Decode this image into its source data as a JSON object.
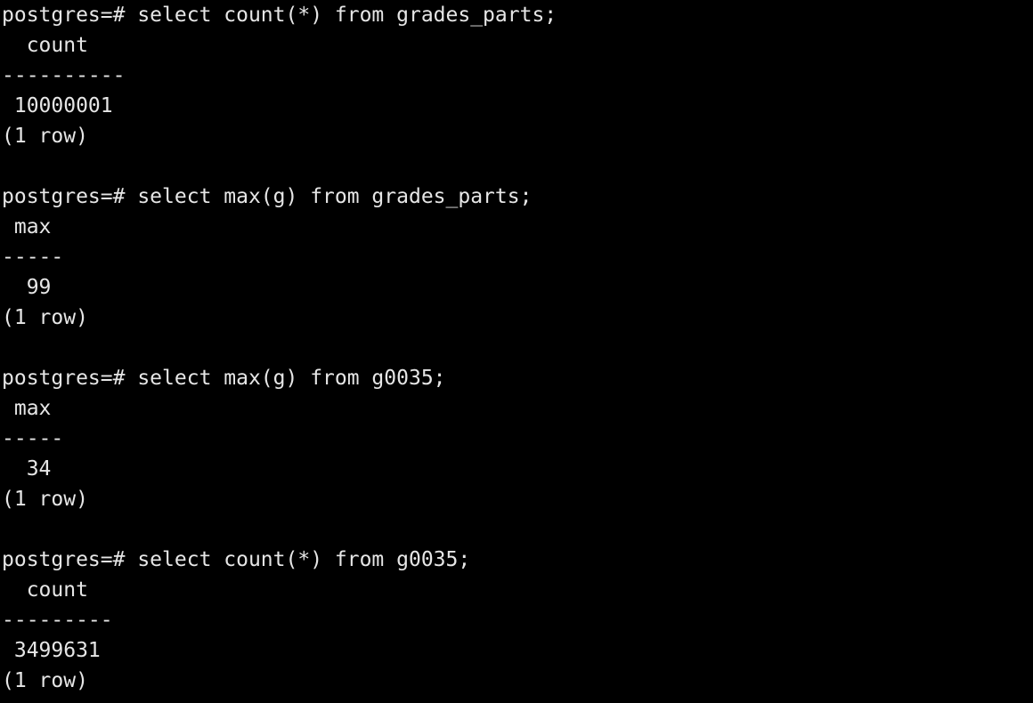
{
  "terminal": {
    "lines": [
      {
        "kind": "command",
        "prompt": "postgres=# ",
        "command": "select count(*) from grades_parts;"
      },
      {
        "kind": "output",
        "text": "  count"
      },
      {
        "kind": "output",
        "text": "----------"
      },
      {
        "kind": "output",
        "text": " 10000001"
      },
      {
        "kind": "output",
        "text": "(1 row)"
      },
      {
        "kind": "blank",
        "text": ""
      },
      {
        "kind": "command",
        "prompt": "postgres=# ",
        "command": "select max(g) from grades_parts;"
      },
      {
        "kind": "output",
        "text": " max"
      },
      {
        "kind": "output",
        "text": "-----"
      },
      {
        "kind": "output",
        "text": "  99"
      },
      {
        "kind": "output",
        "text": "(1 row)"
      },
      {
        "kind": "blank",
        "text": ""
      },
      {
        "kind": "command",
        "prompt": "postgres=# ",
        "command": "select max(g) from g0035;"
      },
      {
        "kind": "output",
        "text": " max"
      },
      {
        "kind": "output",
        "text": "-----"
      },
      {
        "kind": "output",
        "text": "  34"
      },
      {
        "kind": "output",
        "text": "(1 row)"
      },
      {
        "kind": "blank",
        "text": ""
      },
      {
        "kind": "command",
        "prompt": "postgres=# ",
        "command": "select count(*) from g0035;"
      },
      {
        "kind": "output",
        "text": "  count"
      },
      {
        "kind": "output",
        "text": "---------"
      },
      {
        "kind": "output",
        "text": " 3499631"
      },
      {
        "kind": "output",
        "text": "(1 row)"
      }
    ]
  },
  "colors": {
    "background": "#000000",
    "text": "#e6e6e6"
  }
}
